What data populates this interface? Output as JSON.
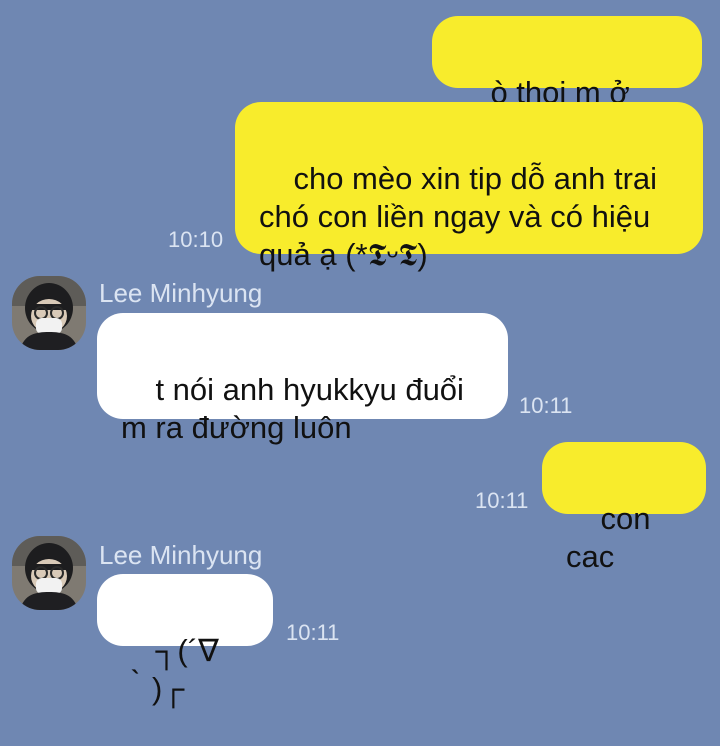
{
  "conversation": {
    "messages": [
      {
        "text": "ò thoi m ở đây i"
      },
      {
        "text": "cho mèo xin tip dỗ anh trai\nchó con liền ngay và có hiệu\nquả ạ (*𝕿ᵕ𝕿)",
        "time": "10:10"
      },
      {
        "sender": "Lee Minhyung",
        "avatar": "profile-photo",
        "text": "t nói anh hyukkyu đuổi\nm ra đường luôn",
        "time": "10:11"
      },
      {
        "text": "con cac",
        "time": "10:11"
      },
      {
        "sender": "Lee Minhyung",
        "avatar": "profile-photo",
        "text": "┐(´∇｀)┌",
        "time": "10:11"
      }
    ]
  },
  "theme": {
    "background": "#6f87b2",
    "my_bubble": "#f8ec2c",
    "their_bubble": "#ffffff",
    "meta_text": "#dbe4f2"
  }
}
